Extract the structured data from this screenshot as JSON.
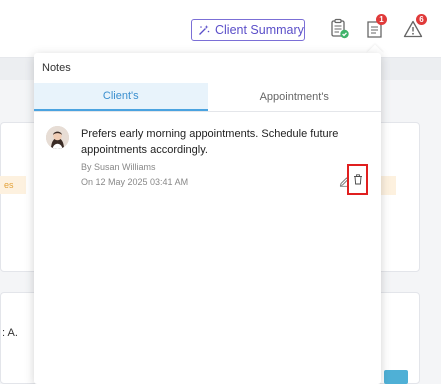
{
  "header": {
    "client_summary_label": "Client Summary",
    "notifications_count": "1",
    "alerts_count": "6",
    "icons": [
      "magic-wand-icon",
      "clipboard-check-icon",
      "notes-icon",
      "warning-icon"
    ]
  },
  "background": {
    "tag_label": "es",
    "row_text": ": A."
  },
  "notes_panel": {
    "title": "Notes",
    "tabs": [
      {
        "label": "Client's",
        "active": true
      },
      {
        "label": "Appointment's",
        "active": false
      }
    ],
    "notes": [
      {
        "text": "Prefers early morning appointments. Schedule future appointments accordingly.",
        "author": "By Susan Williams",
        "date": "On 12 May 2025 03:41 AM"
      }
    ]
  },
  "colors": {
    "accent": "#4aa3e0",
    "summary_button": "#5b4fc9",
    "badge": "#e03a3a",
    "highlight": "#e01f1f"
  }
}
